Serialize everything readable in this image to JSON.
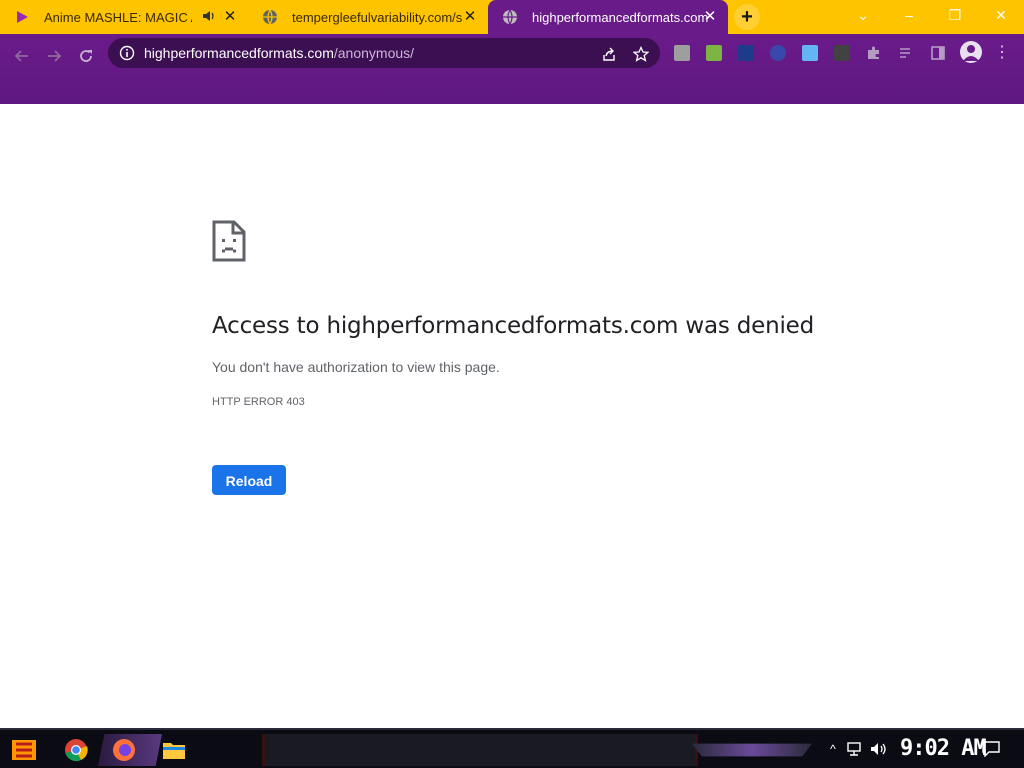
{
  "browser": {
    "tabs": [
      {
        "title": "Anime MASHLE: MAGIC A",
        "icon": "play-icon",
        "audio_icon": "speaker-icon"
      },
      {
        "title": "tempergleefulvariability.com/s",
        "icon": "globe-icon"
      },
      {
        "title": "highperformancedformats.com",
        "icon": "globe-icon",
        "active": true
      }
    ],
    "new_tab_label": "+",
    "window_controls": {
      "dropdown": "⌄",
      "minimize": "–",
      "restore": "❐",
      "close": "✕"
    },
    "address_bar": {
      "host": "highperformancedformats.com",
      "path": "/anonymous/"
    },
    "colors": {
      "tab_strip": "#ffc400",
      "toolbar": "#6a1b8a",
      "omnibox": "#3c0e52"
    }
  },
  "page": {
    "headline": "Access to highperformancedformats.com was denied",
    "message": "You don't have authorization to view this page.",
    "error_code": "HTTP ERROR 403",
    "reload_label": "Reload",
    "accent": "#1a73e8"
  },
  "taskbar": {
    "clock": "9:02 AM",
    "apps": [
      "chrome-icon",
      "firefox-icon",
      "file-explorer-icon"
    ]
  }
}
